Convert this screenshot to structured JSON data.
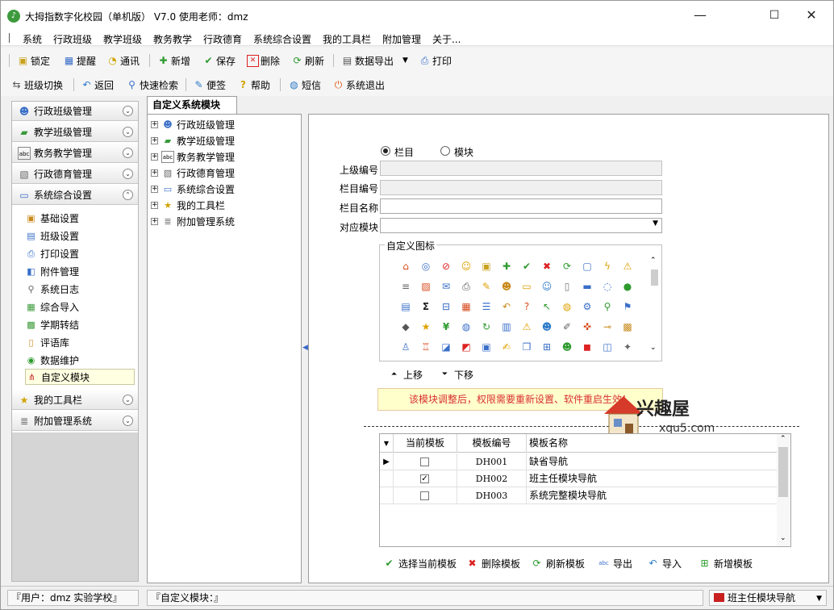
{
  "window": {
    "title": "大拇指数字化校园（单机版）  V7.0 使用老师：dmz",
    "minimize": "—",
    "maximize": "☐",
    "close": "✕"
  },
  "menu": [
    "系统",
    "行政班级",
    "教学班级",
    "教务教学",
    "行政德育",
    "系统综合设置",
    "我的工具栏",
    "附加管理",
    "关于..."
  ],
  "toolbar1": {
    "lock": "锁定",
    "remind": "提醒",
    "comm": "通讯",
    "add": "新增",
    "save": "保存",
    "delete": "删除",
    "refresh": "刷新",
    "export": "数据导出",
    "print": "打印"
  },
  "toolbar2": {
    "switch_class": "班级切换",
    "back": "返回",
    "quick_search": "快速检索",
    "note": "便签",
    "help": "帮助",
    "sms": "短信",
    "exit": "系统退出"
  },
  "sidebar": {
    "groups": [
      "行政班级管理",
      "教学班级管理",
      "教务教学管理",
      "行政德育管理",
      "系统综合设置"
    ],
    "sub_items": [
      "基础设置",
      "班级设置",
      "打印设置",
      "附件管理",
      "系统日志",
      "综合导入",
      "学期转结",
      "评语库",
      "数据维护",
      "自定义模块"
    ],
    "bottom_groups": [
      "我的工具栏",
      "附加管理系统"
    ]
  },
  "tab": {
    "label": "自定义系统模块"
  },
  "tree": [
    "行政班级管理",
    "教学班级管理",
    "教务教学管理",
    "行政德育管理",
    "系统综合设置",
    "我的工具栏",
    "附加管理系统"
  ],
  "form": {
    "radio_column": "栏目",
    "radio_module": "模块",
    "parent_code_label": "上级编号",
    "column_code_label": "栏目编号",
    "column_name_label": "栏目名称",
    "module_label": "对应模块",
    "icon_group_label": "自定义图标",
    "move_up": "上移",
    "move_down": "下移"
  },
  "warning": "该模块调整后，权限需要重新设置、软件重启生效！",
  "table": {
    "headers": [
      "当前模板",
      "模板编号",
      "模板名称"
    ],
    "rows": [
      {
        "code": "DH001",
        "name": "缺省导航",
        "checked": false
      },
      {
        "code": "DH002",
        "name": "班主任模块导航",
        "checked": true
      },
      {
        "code": "DH003",
        "name": "系统完整模块导航",
        "checked": false
      }
    ]
  },
  "bottom_buttons": {
    "select": "选择当前模板",
    "delete": "删除模板",
    "refresh": "刷新模板",
    "export": "导出",
    "import": "导入",
    "add": "新增模板"
  },
  "status": {
    "user": "『用户：dmz 实验学校』",
    "module": "『自定义模块：』",
    "nav": "班主任模块导航"
  },
  "watermark": {
    "brand": "兴趣屋",
    "url": "xqu5.com"
  },
  "colors": {
    "warning_text": "#d83030",
    "warning_bg": "#ffffcc",
    "selected_item_bg": "#ffffe1"
  }
}
